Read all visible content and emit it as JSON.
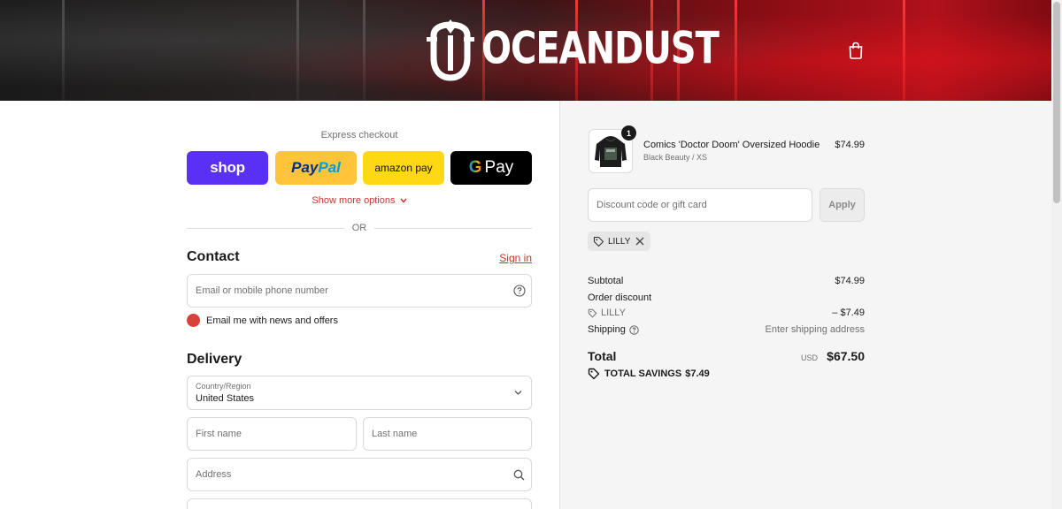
{
  "header": {
    "logo_text": "OCEANDUST",
    "cart_icon": "shopping-bag-icon"
  },
  "express": {
    "label": "Express checkout",
    "shop_label": "shop",
    "paypal_label_a": "Pay",
    "paypal_label_b": "Pal",
    "amazon_label": "amazon pay",
    "gpay_g": "G",
    "gpay_label": "Pay",
    "show_more": "Show more options",
    "or_text": "OR"
  },
  "contact": {
    "title": "Contact",
    "signin": "Sign in",
    "email_placeholder": "Email or mobile phone number",
    "newsletter_label": "Email me with news and offers"
  },
  "delivery": {
    "title": "Delivery",
    "country_label": "Country/Region",
    "country_value": "United States",
    "first_name_placeholder": "First name",
    "last_name_placeholder": "Last name",
    "address_placeholder": "Address"
  },
  "summary": {
    "product": {
      "quantity": "1",
      "name": "Comics 'Doctor Doom' Oversized Hoodie",
      "variant": "Black Beauty / XS",
      "price": "$74.99"
    },
    "discount_placeholder": "Discount code or gift card",
    "apply_label": "Apply",
    "applied_code": "LILLY",
    "subtotal_label": "Subtotal",
    "subtotal_value": "$74.99",
    "order_discount_label": "Order discount",
    "discount_code": "LILLY",
    "discount_value": "– $7.49",
    "shipping_label": "Shipping",
    "shipping_value": "Enter shipping address",
    "total_label": "Total",
    "total_currency": "USD",
    "total_value": "$67.50",
    "savings_label": "TOTAL SAVINGS",
    "savings_value": "$7.49"
  },
  "colors": {
    "accent": "#c7352f",
    "shop_purple": "#5a31f4",
    "paypal_yellow": "#ffc439",
    "amazon_yellow": "#ffd814"
  }
}
